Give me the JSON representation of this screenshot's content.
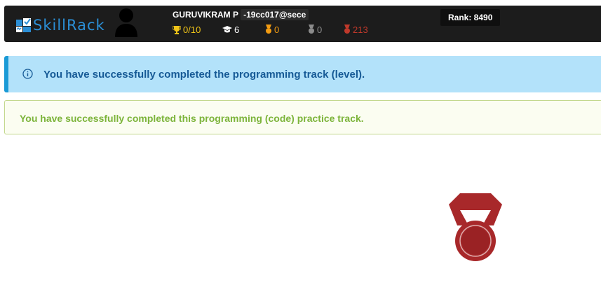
{
  "header": {
    "logo_text": "SkillRack",
    "username": "GURUVIKRAM P",
    "user_id": "-19cc017@sece",
    "rank_label": "Rank: 8490",
    "stats": [
      {
        "icon": "trophy-icon",
        "value": "0/10",
        "color": "#f0c418"
      },
      {
        "icon": "graduation-cap-icon",
        "value": "6",
        "color": "#ffffff"
      },
      {
        "icon": "gold-medal-icon",
        "value": "0",
        "color": "#f39c12"
      },
      {
        "icon": "silver-medal-icon",
        "value": "0",
        "color": "#8c8c8c"
      },
      {
        "icon": "bronze-medal-icon",
        "value": "213",
        "color": "#c0392b"
      }
    ]
  },
  "alerts": {
    "info": "You have successfully completed the programming track (level).",
    "success": "You have successfully completed this programming (code) practice track."
  },
  "colors": {
    "header_bg": "#1c1c1c",
    "info_bg": "#b3e2fa",
    "info_text": "#165a96",
    "success_text": "#7cb43a",
    "medal": "#a8282a"
  },
  "medal_icon": "bronze-medal-icon"
}
